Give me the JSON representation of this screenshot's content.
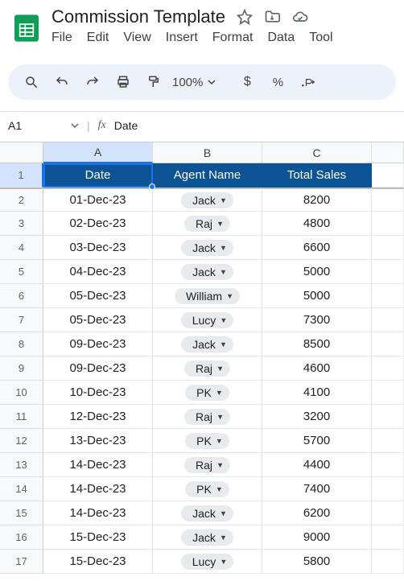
{
  "doc": {
    "title": "Commission Template"
  },
  "menu": {
    "file": "File",
    "edit": "Edit",
    "view": "View",
    "insert": "Insert",
    "format": "Format",
    "data": "Data",
    "tools": "Tool"
  },
  "toolbar": {
    "zoom": "100%",
    "currency": "$",
    "percent": "%"
  },
  "namebox": {
    "ref": "A1",
    "formula_label": "fx",
    "value": "Date"
  },
  "columns": [
    "A",
    "B",
    "C"
  ],
  "headers": {
    "A": "Date",
    "B": "Agent Name",
    "C": "Total Sales"
  },
  "rows": [
    {
      "n": 2,
      "date": "01-Dec-23",
      "agent": "Jack",
      "sales": "8200"
    },
    {
      "n": 3,
      "date": "02-Dec-23",
      "agent": "Raj",
      "sales": "4800"
    },
    {
      "n": 4,
      "date": "03-Dec-23",
      "agent": "Jack",
      "sales": "6600"
    },
    {
      "n": 5,
      "date": "04-Dec-23",
      "agent": "Jack",
      "sales": "5000"
    },
    {
      "n": 6,
      "date": "05-Dec-23",
      "agent": "William",
      "sales": "5000"
    },
    {
      "n": 7,
      "date": "05-Dec-23",
      "agent": "Lucy",
      "sales": "7300"
    },
    {
      "n": 8,
      "date": "09-Dec-23",
      "agent": "Jack",
      "sales": "8500"
    },
    {
      "n": 9,
      "date": "09-Dec-23",
      "agent": "Raj",
      "sales": "4600"
    },
    {
      "n": 10,
      "date": "10-Dec-23",
      "agent": "PK",
      "sales": "4100"
    },
    {
      "n": 11,
      "date": "12-Dec-23",
      "agent": "Raj",
      "sales": "3200"
    },
    {
      "n": 12,
      "date": "13-Dec-23",
      "agent": "PK",
      "sales": "5700"
    },
    {
      "n": 13,
      "date": "14-Dec-23",
      "agent": "Raj",
      "sales": "4400"
    },
    {
      "n": 14,
      "date": "14-Dec-23",
      "agent": "PK",
      "sales": "7400"
    },
    {
      "n": 15,
      "date": "14-Dec-23",
      "agent": "Jack",
      "sales": "6200"
    },
    {
      "n": 16,
      "date": "15-Dec-23",
      "agent": "Jack",
      "sales": "9000"
    },
    {
      "n": 17,
      "date": "15-Dec-23",
      "agent": "Lucy",
      "sales": "5800"
    }
  ],
  "chart_data": {
    "type": "table",
    "columns": [
      "Date",
      "Agent Name",
      "Total Sales"
    ],
    "rows": [
      [
        "01-Dec-23",
        "Jack",
        8200
      ],
      [
        "02-Dec-23",
        "Raj",
        4800
      ],
      [
        "03-Dec-23",
        "Jack",
        6600
      ],
      [
        "04-Dec-23",
        "Jack",
        5000
      ],
      [
        "05-Dec-23",
        "William",
        5000
      ],
      [
        "05-Dec-23",
        "Lucy",
        7300
      ],
      [
        "09-Dec-23",
        "Jack",
        8500
      ],
      [
        "09-Dec-23",
        "Raj",
        4600
      ],
      [
        "10-Dec-23",
        "PK",
        4100
      ],
      [
        "12-Dec-23",
        "Raj",
        3200
      ],
      [
        "13-Dec-23",
        "PK",
        5700
      ],
      [
        "14-Dec-23",
        "Raj",
        4400
      ],
      [
        "14-Dec-23",
        "PK",
        7400
      ],
      [
        "14-Dec-23",
        "Jack",
        6200
      ],
      [
        "15-Dec-23",
        "Jack",
        9000
      ],
      [
        "15-Dec-23",
        "Lucy",
        5800
      ]
    ]
  }
}
